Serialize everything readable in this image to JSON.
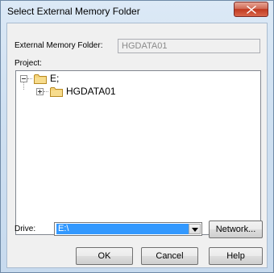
{
  "window": {
    "title": "Select External Memory Folder"
  },
  "external_memory": {
    "label": "External Memory Folder:",
    "value": "HGDATA01"
  },
  "project": {
    "label": "Project:",
    "tree": [
      {
        "label": "E;",
        "expander": "collapse",
        "depth": 0
      },
      {
        "label": "HGDATA01",
        "expander": "expand",
        "depth": 1
      }
    ]
  },
  "drive": {
    "label": "Drive:",
    "selected": "E:\\"
  },
  "buttons": {
    "network": "Network...",
    "ok": "OK",
    "cancel": "Cancel",
    "help": "Help"
  },
  "icons": {
    "close": "close-icon",
    "folder": "folder-icon",
    "expander_collapse": "minus-box-icon",
    "expander_expand": "plus-box-icon",
    "dropdown": "chevron-down-icon"
  }
}
